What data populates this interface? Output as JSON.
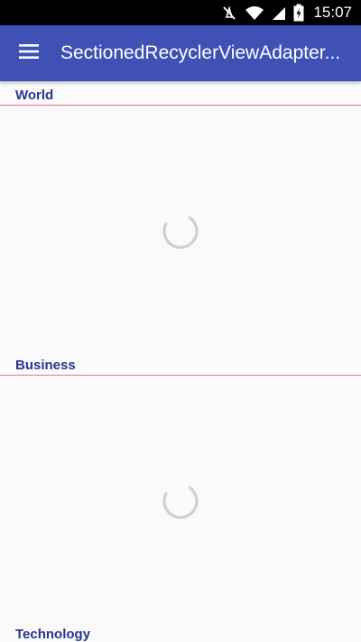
{
  "status_bar": {
    "time": "15:07",
    "icons": [
      "mute-icon",
      "wifi-icon",
      "signal-icon",
      "battery-icon"
    ]
  },
  "app_bar": {
    "title": "SectionedRecyclerViewAdapter..."
  },
  "sections": [
    {
      "title": "World",
      "loading": true
    },
    {
      "title": "Business",
      "loading": true
    },
    {
      "title": "Technology",
      "loading": false
    }
  ],
  "colors": {
    "primary": "#3f51b5",
    "section_title": "#283593",
    "divider": "#ef6f90",
    "background": "#fafafa"
  }
}
